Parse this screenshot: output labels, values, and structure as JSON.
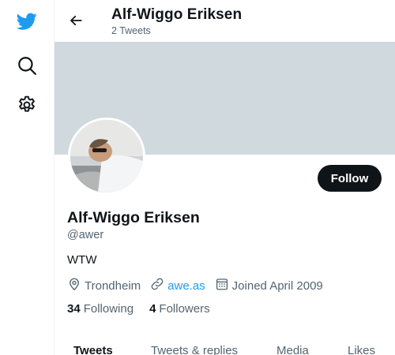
{
  "nav": {
    "icons": [
      "twitter-bird-icon",
      "search-icon",
      "settings-gear-icon"
    ],
    "brand_color": "#1d9bf0"
  },
  "header": {
    "name": "Alf-Wiggo Eriksen",
    "tweet_count": "2 Tweets"
  },
  "banner": {
    "color": "#cfd9de"
  },
  "profile": {
    "name": "Alf-Wiggo Eriksen",
    "handle": "@awer",
    "bio": "WTW",
    "location": "Trondheim",
    "website": "awe.as",
    "joined": "Joined April 2009",
    "follow_label": "Follow",
    "following_count": "34",
    "following_label": "Following",
    "followers_count": "4",
    "followers_label": "Followers"
  },
  "tabs": [
    {
      "label": "Tweets",
      "active": true
    },
    {
      "label": "Tweets & replies",
      "active": false
    },
    {
      "label": "Media",
      "active": false
    },
    {
      "label": "Likes",
      "active": false
    }
  ],
  "colors": {
    "text_primary": "#0f1419",
    "text_secondary": "#536471",
    "link": "#1d9bf0",
    "button": "#0f1419"
  }
}
